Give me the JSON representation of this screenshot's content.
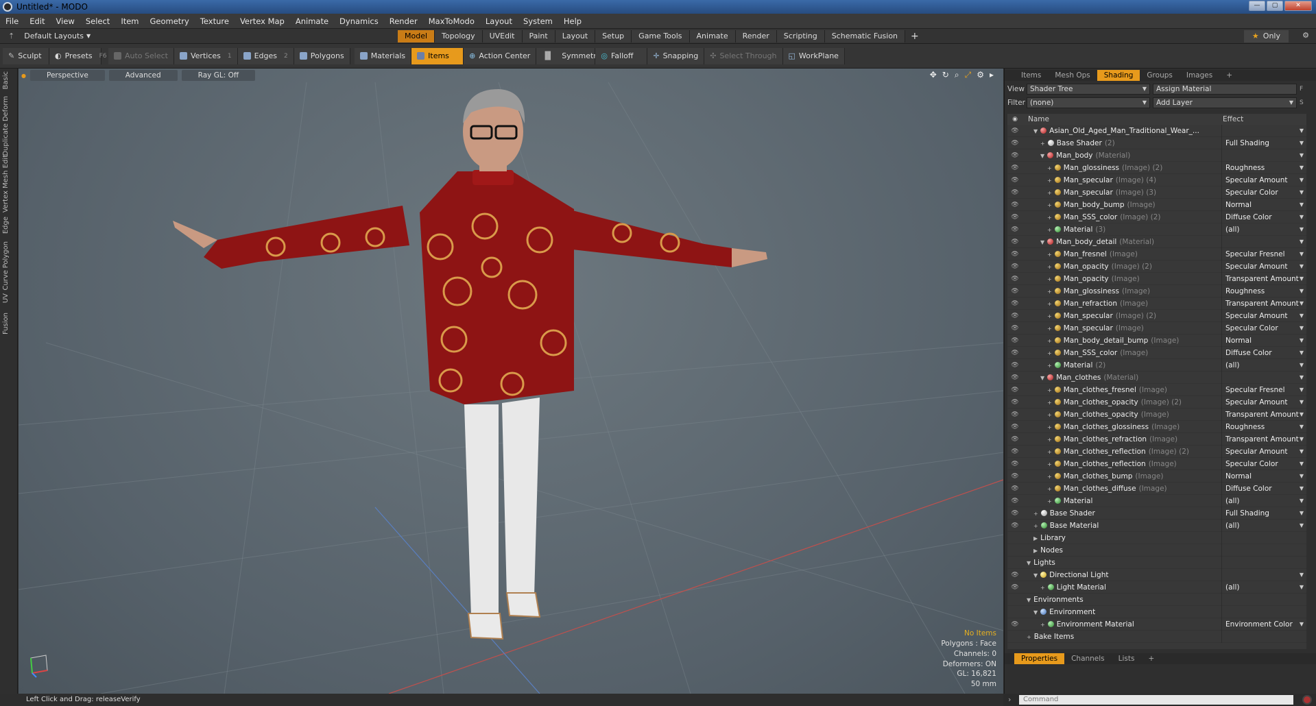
{
  "window": {
    "title": "Untitled* - MODO"
  },
  "menu": [
    "File",
    "Edit",
    "View",
    "Select",
    "Item",
    "Geometry",
    "Texture",
    "Vertex Map",
    "Animate",
    "Dynamics",
    "Render",
    "MaxToModo",
    "Layout",
    "System",
    "Help"
  ],
  "layout": {
    "selector": "Default Layouts",
    "tabs": [
      "Model",
      "Topology",
      "UVEdit",
      "Paint",
      "Layout",
      "Setup",
      "Game Tools",
      "Animate",
      "Render",
      "Scripting",
      "Schematic Fusion"
    ],
    "active_tab": "Model",
    "only_label": "Only"
  },
  "toolbar": {
    "sculpt": "Sculpt",
    "presets": "Presets",
    "presets_key": "F6",
    "auto_select": "Auto Select",
    "vertices": "Vertices",
    "vertices_num": "1",
    "edges": "Edges",
    "edges_num": "2",
    "polygons": "Polygons",
    "materials": "Materials",
    "items": "Items",
    "action_center": "Action Center",
    "symmetry": "Symmetry",
    "falloff": "Falloff",
    "snapping": "Snapping",
    "select_through": "Select Through",
    "workplane": "WorkPlane"
  },
  "left_tabs": [
    "Basic",
    "Deform",
    "Duplicate",
    "Mesh Edit",
    "Vertex",
    "Edge",
    "Polygon",
    "Curve",
    "UV",
    "Fusion"
  ],
  "viewport": {
    "view_mode": "Perspective",
    "shading": "Advanced",
    "raygl": "Ray GL: Off",
    "info": {
      "no_items": "No Items",
      "polygons": "Polygons : Face",
      "channels": "Channels: 0",
      "deformers": "Deformers: ON",
      "gl": "GL: 16,821",
      "focal": "50 mm"
    }
  },
  "status": {
    "hint": "Left Click and Drag:  releaseVerify"
  },
  "panel": {
    "tabs": [
      "Items",
      "Mesh Ops",
      "Shading",
      "Groups",
      "Images"
    ],
    "active_tab": "Shading",
    "view_label": "View",
    "view_value": "Shader Tree",
    "assign_material": "Assign Material",
    "filter_label": "Filter",
    "filter_value": "(none)",
    "add_layer": "Add Layer",
    "col_name": "Name",
    "col_effect": "Effect",
    "bottom_tabs": [
      "Properties",
      "Channels",
      "Lists"
    ],
    "bottom_active": "Properties",
    "command_placeholder": "Command"
  },
  "tree": [
    {
      "indent": 1,
      "ball": "mat",
      "name": "Asian_Old_Aged_Man_Traditional_Wear_...",
      "sub": "",
      "effect": "",
      "exp": "▼"
    },
    {
      "indent": 2,
      "ball": "shd",
      "name": "Base Shader",
      "sub": "(2)",
      "effect": "Full Shading"
    },
    {
      "indent": 2,
      "ball": "mat",
      "name": "Man_body",
      "sub": "(Material)",
      "effect": "",
      "exp": "▼"
    },
    {
      "indent": 3,
      "ball": "img",
      "name": "Man_glossiness",
      "sub": "(Image) (2)",
      "effect": "Roughness"
    },
    {
      "indent": 3,
      "ball": "img",
      "name": "Man_specular",
      "sub": "(Image) (4)",
      "effect": "Specular Amount"
    },
    {
      "indent": 3,
      "ball": "img",
      "name": "Man_specular",
      "sub": "(Image) (3)",
      "effect": "Specular Color"
    },
    {
      "indent": 3,
      "ball": "img",
      "name": "Man_body_bump",
      "sub": "(Image)",
      "effect": "Normal"
    },
    {
      "indent": 3,
      "ball": "img",
      "name": "Man_SSS_color",
      "sub": "(Image) (2)",
      "effect": "Diffuse Color"
    },
    {
      "indent": 3,
      "ball": "grn",
      "name": "Material",
      "sub": "(3)",
      "effect": "(all)"
    },
    {
      "indent": 2,
      "ball": "mat",
      "name": "Man_body_detail",
      "sub": "(Material)",
      "effect": "",
      "exp": "▼"
    },
    {
      "indent": 3,
      "ball": "img",
      "name": "Man_fresnel",
      "sub": "(Image)",
      "effect": "Specular Fresnel"
    },
    {
      "indent": 3,
      "ball": "img",
      "name": "Man_opacity",
      "sub": "(Image) (2)",
      "effect": "Specular Amount"
    },
    {
      "indent": 3,
      "ball": "img",
      "name": "Man_opacity",
      "sub": "(Image)",
      "effect": "Transparent Amount"
    },
    {
      "indent": 3,
      "ball": "img",
      "name": "Man_glossiness",
      "sub": "(Image)",
      "effect": "Roughness"
    },
    {
      "indent": 3,
      "ball": "img",
      "name": "Man_refraction",
      "sub": "(Image)",
      "effect": "Transparent Amount"
    },
    {
      "indent": 3,
      "ball": "img",
      "name": "Man_specular",
      "sub": "(Image) (2)",
      "effect": "Specular Amount"
    },
    {
      "indent": 3,
      "ball": "img",
      "name": "Man_specular",
      "sub": "(Image)",
      "effect": "Specular Color"
    },
    {
      "indent": 3,
      "ball": "img",
      "name": "Man_body_detail_bump",
      "sub": "(Image)",
      "effect": "Normal"
    },
    {
      "indent": 3,
      "ball": "img",
      "name": "Man_SSS_color",
      "sub": "(Image)",
      "effect": "Diffuse Color"
    },
    {
      "indent": 3,
      "ball": "grn",
      "name": "Material",
      "sub": "(2)",
      "effect": "(all)"
    },
    {
      "indent": 2,
      "ball": "mat",
      "name": "Man_clothes",
      "sub": "(Material)",
      "effect": "",
      "exp": "▼"
    },
    {
      "indent": 3,
      "ball": "img",
      "name": "Man_clothes_fresnel",
      "sub": "(Image)",
      "effect": "Specular Fresnel"
    },
    {
      "indent": 3,
      "ball": "img",
      "name": "Man_clothes_opacity",
      "sub": "(Image) (2)",
      "effect": "Specular Amount"
    },
    {
      "indent": 3,
      "ball": "img",
      "name": "Man_clothes_opacity",
      "sub": "(Image)",
      "effect": "Transparent Amount"
    },
    {
      "indent": 3,
      "ball": "img",
      "name": "Man_clothes_glossiness",
      "sub": "(Image)",
      "effect": "Roughness"
    },
    {
      "indent": 3,
      "ball": "img",
      "name": "Man_clothes_refraction",
      "sub": "(Image)",
      "effect": "Transparent Amount"
    },
    {
      "indent": 3,
      "ball": "img",
      "name": "Man_clothes_reflection",
      "sub": "(Image) (2)",
      "effect": "Specular Amount"
    },
    {
      "indent": 3,
      "ball": "img",
      "name": "Man_clothes_reflection",
      "sub": "(Image)",
      "effect": "Specular Color"
    },
    {
      "indent": 3,
      "ball": "img",
      "name": "Man_clothes_bump",
      "sub": "(Image)",
      "effect": "Normal"
    },
    {
      "indent": 3,
      "ball": "img",
      "name": "Man_clothes_diffuse",
      "sub": "(Image)",
      "effect": "Diffuse Color"
    },
    {
      "indent": 3,
      "ball": "grn",
      "name": "Material",
      "sub": "",
      "effect": "(all)"
    },
    {
      "indent": 1,
      "ball": "shd",
      "name": "Base Shader",
      "sub": "",
      "effect": "Full Shading"
    },
    {
      "indent": 1,
      "ball": "grn",
      "name": "Base Material",
      "sub": "",
      "effect": "(all)"
    },
    {
      "indent": 1,
      "ball": "",
      "name": "Library",
      "sub": "",
      "effect": "",
      "exp": "▶",
      "noeye": true
    },
    {
      "indent": 1,
      "ball": "",
      "name": "Nodes",
      "sub": "",
      "effect": "",
      "exp": "▶",
      "noeye": true
    },
    {
      "indent": 0,
      "ball": "",
      "name": "Lights",
      "sub": "",
      "effect": "",
      "exp": "▼",
      "noeye": true
    },
    {
      "indent": 1,
      "ball": "lt",
      "name": "Directional Light",
      "sub": "",
      "effect": "",
      "exp": "▼"
    },
    {
      "indent": 2,
      "ball": "grn",
      "name": "Light Material",
      "sub": "",
      "effect": "(all)"
    },
    {
      "indent": 0,
      "ball": "",
      "name": "Environments",
      "sub": "",
      "effect": "",
      "exp": "▼",
      "noeye": true
    },
    {
      "indent": 1,
      "ball": "env",
      "name": "Environment",
      "sub": "",
      "effect": "",
      "exp": "▼",
      "noeye": true
    },
    {
      "indent": 2,
      "ball": "grn",
      "name": "Environment Material",
      "sub": "",
      "effect": "Environment Color"
    },
    {
      "indent": 0,
      "ball": "",
      "name": "Bake Items",
      "sub": "",
      "effect": "",
      "noeye": true
    }
  ],
  "colors": {
    "accent": "#e79a1c",
    "shirt": "#8e1414",
    "pattern": "#d99a4a",
    "pants": "#e8e8e8",
    "skin": "#c99a82",
    "hair": "#9a9a9a"
  }
}
